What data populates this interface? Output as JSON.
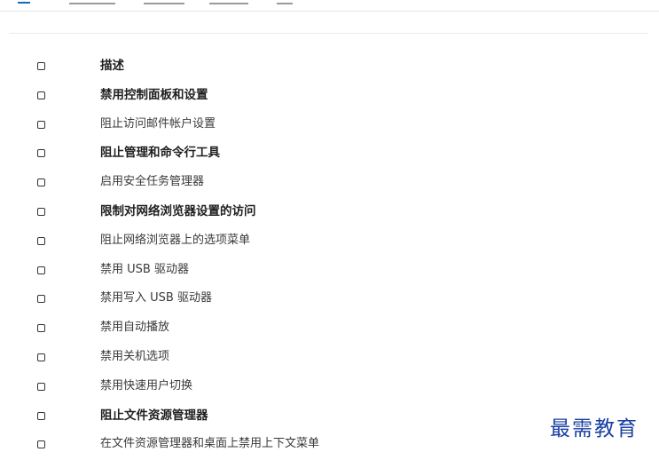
{
  "colors": {
    "accent": "#0f6cbd",
    "watermark": "#1a3fa3"
  },
  "policies": [
    {
      "label": "描述",
      "bold": true,
      "checked": false
    },
    {
      "label": "禁用控制面板和设置",
      "bold": true,
      "checked": false
    },
    {
      "label": "阻止访问邮件帐户设置",
      "bold": false,
      "checked": false
    },
    {
      "label": "阻止管理和命令行工具",
      "bold": true,
      "checked": false
    },
    {
      "label": "启用安全任务管理器",
      "bold": false,
      "checked": false
    },
    {
      "label": "限制对网络浏览器设置的访问",
      "bold": true,
      "checked": false
    },
    {
      "label": "阻止网络浏览器上的选项菜单",
      "bold": false,
      "checked": false
    },
    {
      "label": "禁用 USB 驱动器",
      "bold": false,
      "checked": false
    },
    {
      "label": "禁用写入 USB 驱动器",
      "bold": false,
      "checked": false
    },
    {
      "label": "禁用自动播放",
      "bold": false,
      "checked": false
    },
    {
      "label": "禁用关机选项",
      "bold": false,
      "checked": false
    },
    {
      "label": "禁用快速用户切换",
      "bold": false,
      "checked": false
    },
    {
      "label": "阻止文件资源管理器",
      "bold": true,
      "checked": false
    },
    {
      "label": "在文件资源管理器和桌面上禁用上下文菜单",
      "bold": false,
      "checked": false
    }
  ],
  "watermark": "最需教育"
}
